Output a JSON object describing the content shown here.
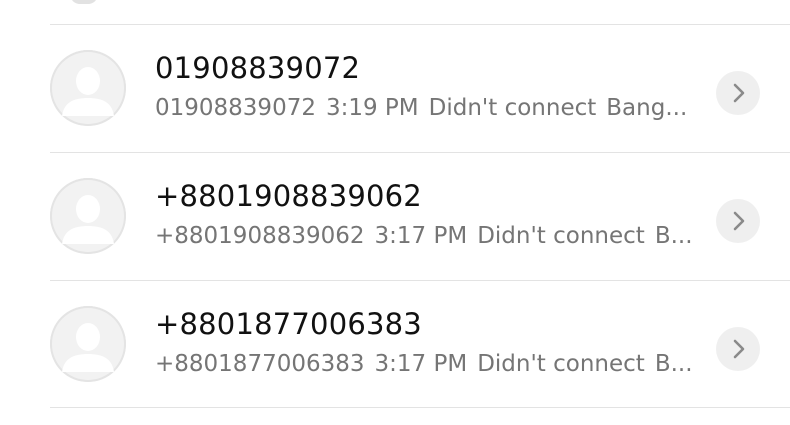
{
  "call_log": {
    "entries": [
      {
        "title": "01908839072",
        "number": "01908839072",
        "time": "3:19 PM",
        "status": "Didn't connect",
        "location": "Bang..."
      },
      {
        "title": "+8801908839062",
        "number": "+8801908839062",
        "time": "3:17 PM",
        "status": "Didn't connect",
        "location": "B..."
      },
      {
        "title": "+8801877006383",
        "number": "+8801877006383",
        "time": "3:17 PM",
        "status": "Didn't connect",
        "location": "B..."
      }
    ],
    "icons": {
      "avatar": "default-contact-avatar-icon",
      "detail": "chevron-right-icon"
    },
    "colors": {
      "title_text": "#111111",
      "subtitle_text": "#757575",
      "avatar_bg": "#e4e4e4",
      "divider": "#e3e3e3",
      "detail_button_bg": "#efefef"
    }
  }
}
